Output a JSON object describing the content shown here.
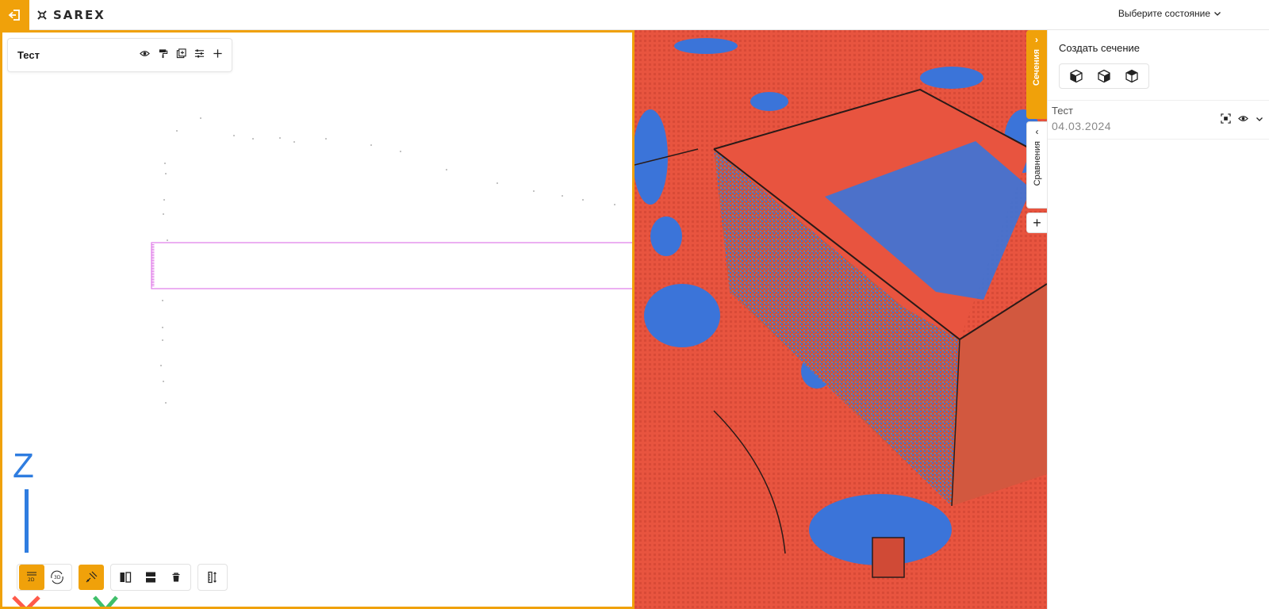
{
  "header": {
    "logo_text": "SAREX",
    "state_select": {
      "value": "Выберите состояние"
    },
    "accent_color": "#f0a10a"
  },
  "layer_card": {
    "name": "Тест",
    "tools": [
      "eye-icon",
      "paint-roller-icon",
      "image-add-icon",
      "sliders-icon",
      "plus-icon"
    ]
  },
  "axes": {
    "z_label": "Z"
  },
  "bottom_toolbar": {
    "mode_2d_label": "2D",
    "mode_3d_label": "3D",
    "active": [
      "mode-2d",
      "satellite-tool"
    ]
  },
  "side_tabs": {
    "sections": "Сечения",
    "compare": "Сравнения",
    "add": "+"
  },
  "right_panel": {
    "title": "Создать сечение",
    "section": {
      "name": "Тест",
      "date": "04.03.2024"
    }
  },
  "colors": {
    "cloud_red": "#e8543f",
    "cloud_blue": "#3b74d9",
    "section_line": "#e07be8"
  }
}
